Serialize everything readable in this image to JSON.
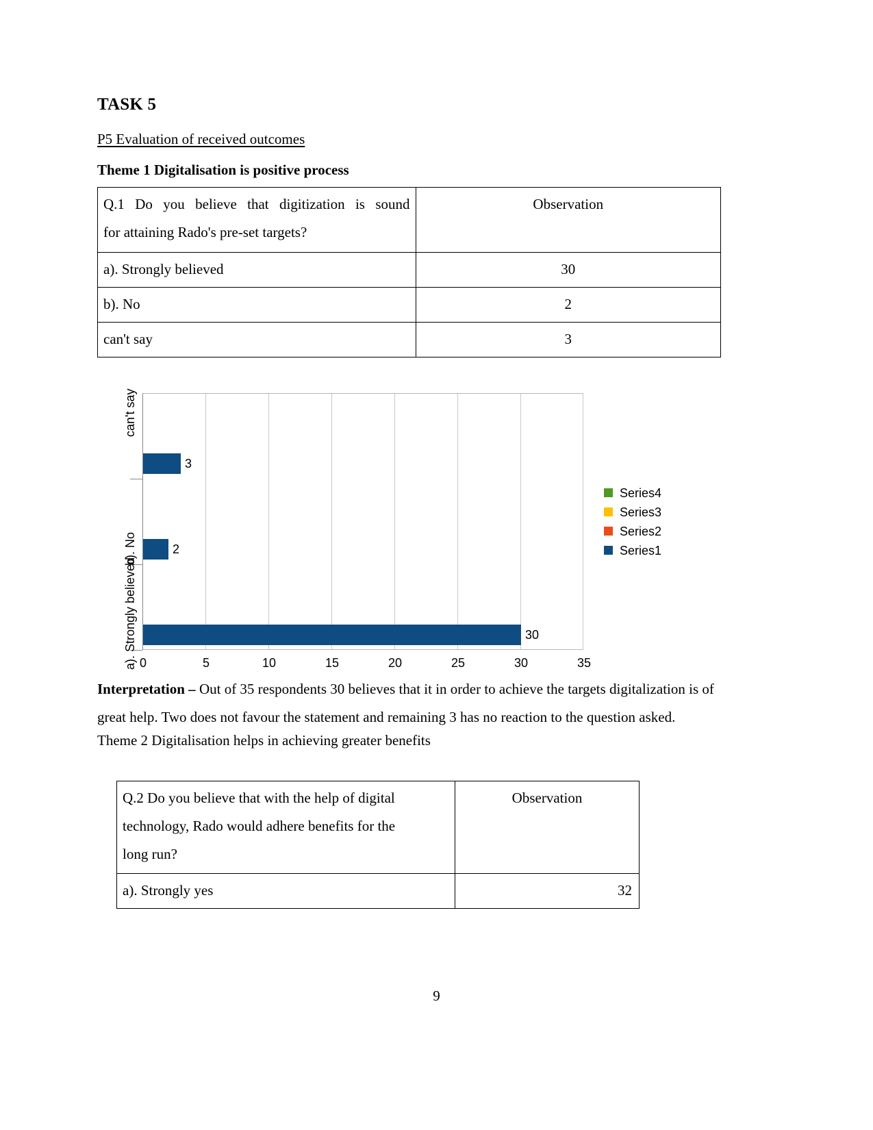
{
  "document": {
    "task_heading": "TASK 5",
    "p5_line": "P5 Evaluation of received outcomes",
    "theme1_line": "Theme 1 Digitalisation is positive process",
    "theme2_line": "Theme 2 Digitalisation helps in achieving greater benefits",
    "page_number": "9"
  },
  "table_q1": {
    "question_line1": "Q.1  Do  you  believe  that  digitization  is  sound",
    "question_line2": "for attaining Rado's pre-set targets?",
    "observation_header": "Observation",
    "rows": [
      {
        "option": "a). Strongly believed",
        "observation": "30"
      },
      {
        "option": "b). No",
        "observation": "2"
      },
      {
        "option": "can't say",
        "observation": "3"
      }
    ]
  },
  "interpretation": {
    "label": "Interpretation – ",
    "text": "Out of 35 respondents 30 believes that it in order to achieve the targets digitalization is of great help. Two does not favour the statement and remaining 3 has no reaction to the question asked."
  },
  "table_q2": {
    "question_line1": "Q.2 Do you believe that with the help of digital",
    "question_line2": "technology, Rado would adhere benefits for the",
    "question_line3": "long run?",
    "observation_header": "Observation",
    "rows": [
      {
        "option": "a). Strongly yes",
        "observation": "32"
      }
    ]
  },
  "chart_data": {
    "type": "bar",
    "orientation": "horizontal",
    "title": "",
    "xlabel": "",
    "ylabel": "",
    "categories": [
      "a). Strongly believed",
      "b). No",
      "can't say"
    ],
    "values": [
      30,
      2,
      3
    ],
    "data_labels": [
      "30",
      "2",
      "3"
    ],
    "xlim": [
      0,
      35
    ],
    "xticks": [
      0,
      5,
      10,
      15,
      20,
      25,
      30,
      35
    ],
    "xtick_labels": [
      "0",
      "5",
      "10",
      "15",
      "20",
      "25",
      "30",
      "35"
    ],
    "grid": "vertical",
    "legend_position": "right",
    "series": [
      {
        "name": "Series1",
        "color": "#0f4c81",
        "values": [
          30,
          2,
          3
        ]
      },
      {
        "name": "Series2",
        "color": "#ed4b1c",
        "values": []
      },
      {
        "name": "Series3",
        "color": "#ffc000",
        "values": []
      },
      {
        "name": "Series4",
        "color": "#4e9a23",
        "values": []
      }
    ],
    "legend_entries": [
      {
        "label": "Series4",
        "color": "#4e9a23"
      },
      {
        "label": "Series3",
        "color": "#ffc000"
      },
      {
        "label": "Series2",
        "color": "#ed4b1c"
      },
      {
        "label": "Series1",
        "color": "#0f4c81"
      }
    ]
  }
}
